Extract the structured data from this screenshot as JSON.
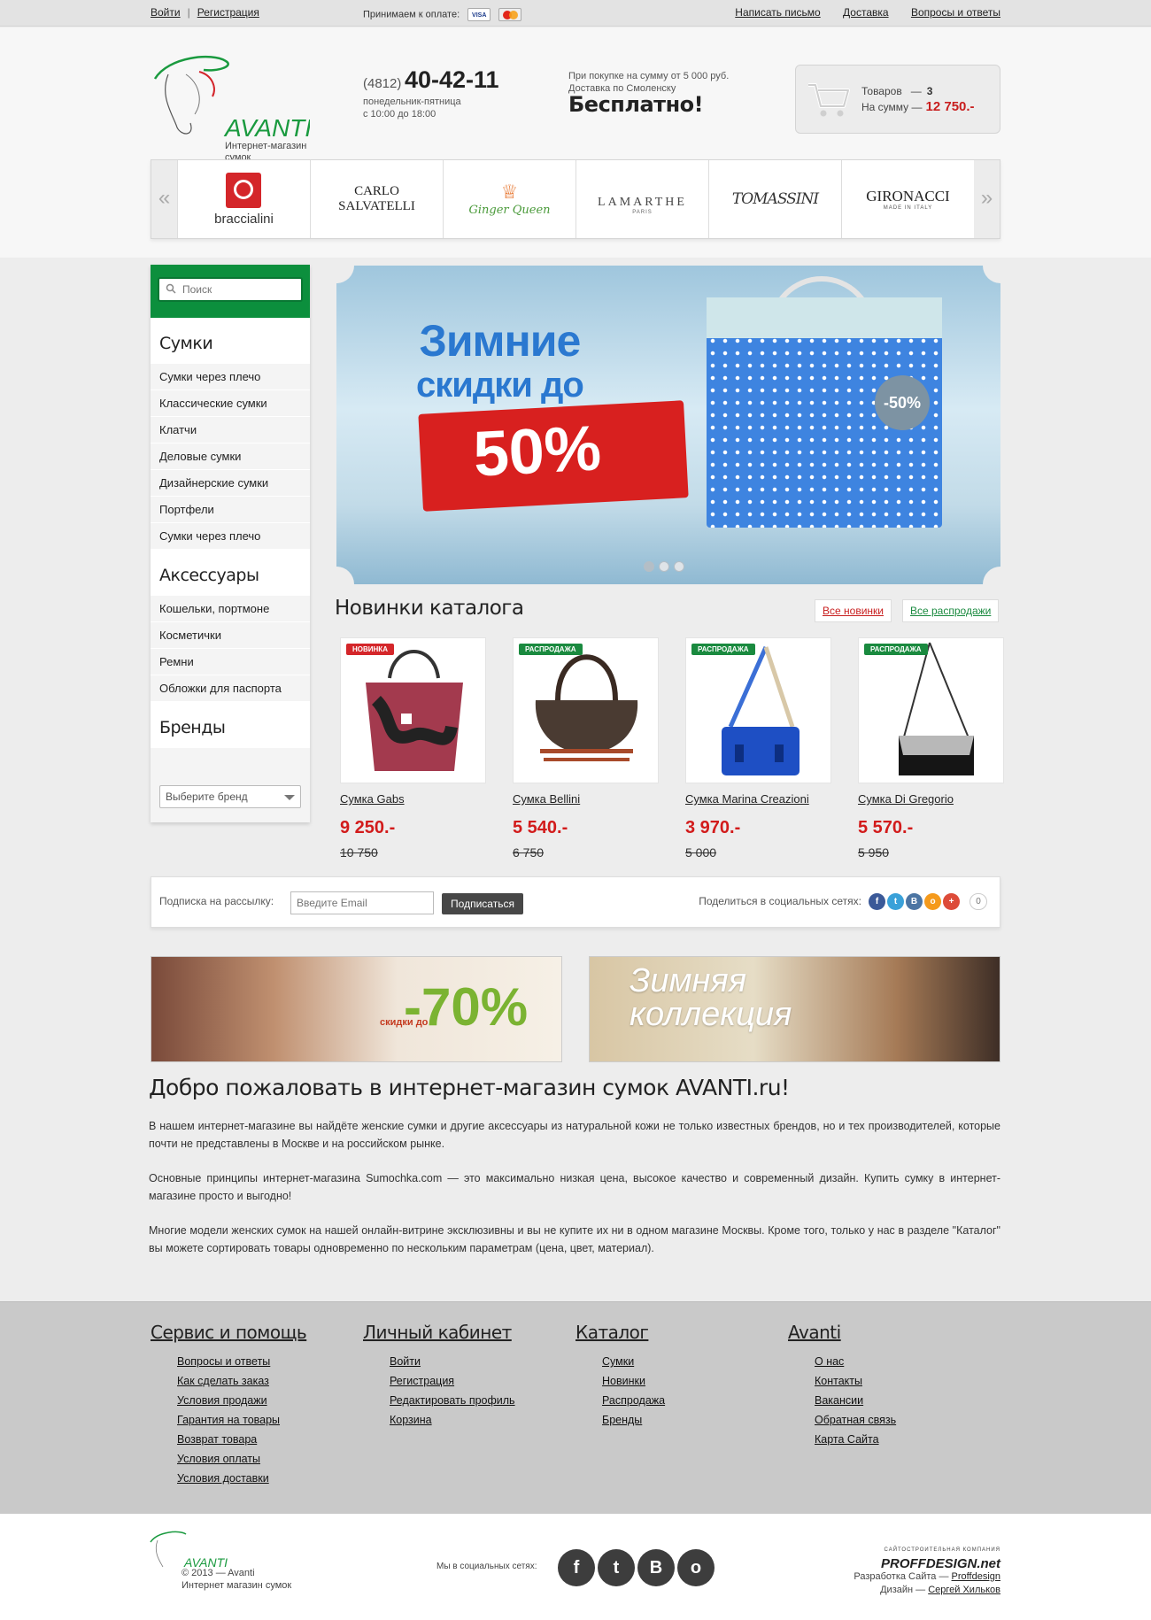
{
  "topbar": {
    "login": "Войти",
    "sep": "|",
    "register": "Регистрация",
    "pay_label": "Принимаем к оплате:",
    "card1": "VISA",
    "card2": "MasterCard",
    "links": [
      "Написать письмо",
      "Доставка",
      "Вопросы и ответы"
    ]
  },
  "header": {
    "logo_text": "AVANTI",
    "logo_sub": "Интернет-магазин сумок",
    "phone_code": "(4812)",
    "phone_number": "40-42-11",
    "hours1": "понедельник-пятница",
    "hours2": "с 10:00 до 18:00",
    "promo1": "При покупке на сумму от 5 000 руб.",
    "promo2": "Доставка по Смоленску",
    "promo_big": "Бесплатно!",
    "cart": {
      "items_label": "Товаров",
      "items_dash": "—",
      "items_count": "3",
      "sum_label": "На сумму —",
      "sum_value": "12 750.-"
    }
  },
  "brands": {
    "prev": "«",
    "next": "»",
    "items": [
      "braccialini",
      "CARLO SALVATELLI",
      "Ginger Queen",
      "LAMARTHE",
      "TOMASSINI",
      "GIRONACCI"
    ],
    "sub_lamarthe": "PARIS",
    "sub_gironacci": "MADE IN ITALY"
  },
  "sidebar": {
    "search_placeholder": "Поиск",
    "sections": [
      {
        "title": "Сумки",
        "items": [
          "Сумки через плечо",
          "Классические сумки",
          "Клатчи",
          "Деловые сумки",
          "Дизайнерские сумки",
          "Портфели",
          "Сумки через плечо"
        ]
      },
      {
        "title": "Аксессуары",
        "items": [
          "Кошельки, портмоне",
          "Косметички",
          "Ремни",
          "Обложки для паспорта"
        ]
      },
      {
        "title": "Бренды",
        "items": []
      }
    ],
    "brand_select": "Выберите бренд"
  },
  "banner": {
    "line1": "Зимние",
    "line2": "скидки до",
    "percent": "50%",
    "tag": "-50%"
  },
  "catalog": {
    "title": "Новинки каталога",
    "all_new": "Все новинки",
    "all_sales": "Все распродажи",
    "products": [
      {
        "badge": "НОВИНКА",
        "name": "Сумка Gabs",
        "price": "9 250.-",
        "old": "10 750",
        "badge_color": "#d4262a"
      },
      {
        "badge": "РАСПРОДАЖА",
        "name": "Сумка Bellini",
        "price": "5 540.-",
        "old": "6 750",
        "badge_color": "#1a8a3f"
      },
      {
        "badge": "РАСПРОДАЖА",
        "name": "Сумка Marina Creazioni",
        "price": "3 970.-",
        "old": "5 000",
        "badge_color": "#1a8a3f"
      },
      {
        "badge": "РАСПРОДАЖА",
        "name": "Сумка Di Gregorio",
        "price": "5 570.-",
        "old": "5 950",
        "badge_color": "#1a8a3f"
      }
    ]
  },
  "subscribe": {
    "label": "Подписка на рассылку:",
    "placeholder": "Введите Email",
    "button": "Подписаться",
    "share_label": "Поделиться в социальных сетях:",
    "share_count": "0",
    "share_icons": [
      "f",
      "t",
      "B",
      "о",
      "+"
    ]
  },
  "promo_banners": {
    "sale_upto": "скидки до",
    "sale_pct": "-70%",
    "winter_line1": "Зимняя",
    "winter_line2": "коллекция"
  },
  "welcome": {
    "title": "Добро пожаловать в интернет-магазин сумок AVANTI.ru!",
    "p1": "В нашем интернет-магазине вы найдёте женские сумки и другие аксессуары из натуральной кожи не только известных брендов, но и тех производителей, которые почти не представлены в Москве и на российском рынке.",
    "p2": "Основные принципы интернет-магазина Sumochka.com — это максимально низкая цена, высокое качество и современный дизайн. Купить сумку в интернет-магазине просто и выгодно!",
    "p3": "Многие модели женских сумок на нашей онлайн-витрине эксклюзивны и вы не купите их ни в одном магазине Москвы. Кроме того, только у нас в разделе \"Каталог\" вы можете сортировать товары одновременно по нескольким параметрам (цена, цвет, материал)."
  },
  "footer": {
    "columns": [
      {
        "title": "Сервис и помощь",
        "links": [
          "Вопросы и ответы",
          "Как сделать заказ",
          "Условия продажи",
          "Гарантия на товары",
          "Возврат товара",
          "Условия оплаты",
          "Условия доставки"
        ]
      },
      {
        "title": "Личный кабинет",
        "links": [
          "Войти",
          "Регистрация",
          "Редактировать профиль",
          "Корзина"
        ]
      },
      {
        "title": "Каталог",
        "links": [
          "Сумки",
          "Новинки",
          "Распродажа",
          "Бренды"
        ]
      },
      {
        "title": "Avanti",
        "links": [
          "О нас",
          "Контакты",
          "Вакансии",
          "Обратная связь",
          "Карта Сайта"
        ]
      }
    ],
    "copyright": "© 2013 — Avanti",
    "copyright_sub": "Интернет магазин сумок",
    "social_label": "Мы в социальных сетях:",
    "social_icons": [
      "f",
      "t",
      "B",
      "о"
    ],
    "dev_brand_top": "САЙТОСТРОИТЕЛЬНАЯ КОМПАНИЯ",
    "dev_brand": "PROFFDESIGN.net",
    "dev_label": "Разработка Сайта —",
    "dev_link": "Proffdesign",
    "design_label": "Дизайн —",
    "design_link": "Сергей Хильков"
  },
  "colors": {
    "brand_green": "#0c8f3d",
    "price_red": "#d21b1b",
    "sale_green": "#1a8a3f",
    "new_red": "#d4262a"
  }
}
